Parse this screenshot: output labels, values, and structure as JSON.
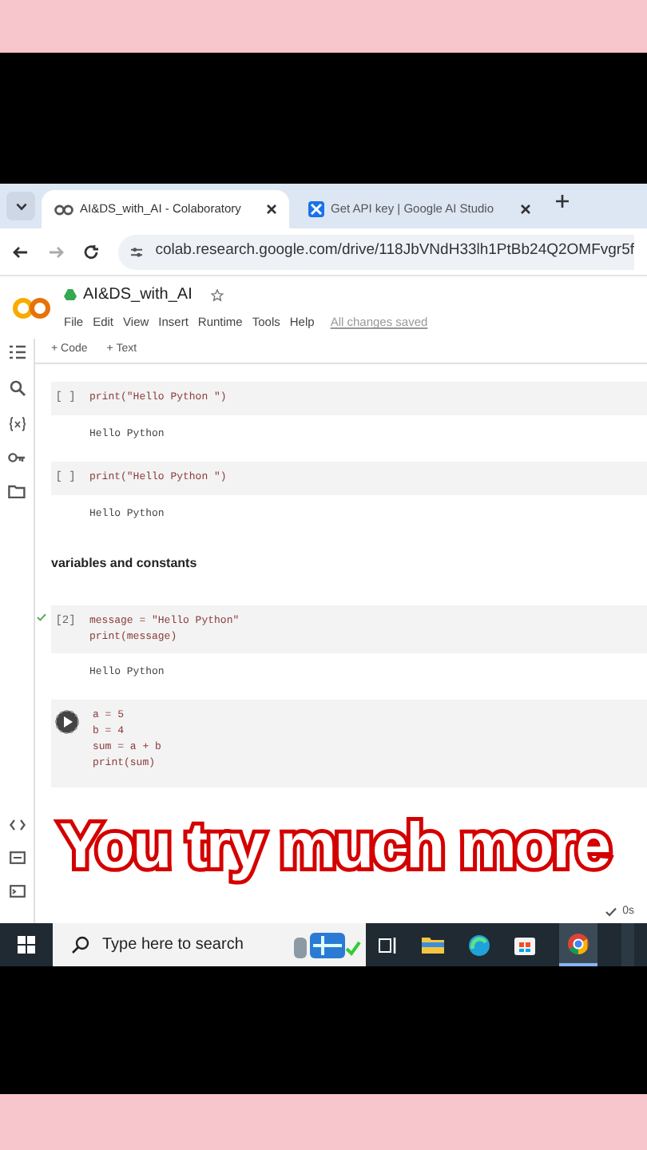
{
  "tabs": [
    {
      "label": "AI&DS_with_AI - Colaboratory",
      "selected": true
    },
    {
      "label": "Get API key | Google AI Studio",
      "selected": false
    }
  ],
  "address": "colab.research.google.com/drive/118JbVNdH33lh1PtBb24Q2OMFvgr5f",
  "notebook": {
    "title": "AI&DS_with_AI",
    "menu": [
      "File",
      "Edit",
      "View",
      "Insert",
      "Runtime",
      "Tools",
      "Help"
    ],
    "save_status": "All changes saved"
  },
  "toolbar": [
    "+ Code",
    "+ Text"
  ],
  "cells": [
    {
      "kind": "code",
      "prompt": "[ ]",
      "lines": [
        "print(\"Hello Python \")"
      ],
      "output": "Hello Python"
    },
    {
      "kind": "code",
      "prompt": "[ ]",
      "lines": [
        "print(\"Hello Python \")"
      ],
      "output": "Hello Python"
    },
    {
      "kind": "text",
      "text": "variables and constants"
    },
    {
      "kind": "code",
      "prompt": "[2]",
      "ran": true,
      "lines": [
        "message = \"Hello Python\"",
        "print(message)"
      ],
      "output": "Hello Python"
    },
    {
      "kind": "running",
      "lines": [
        "a = 5",
        "b = 4",
        "sum = a + b",
        "print(sum)"
      ]
    }
  ],
  "status": "0s",
  "caption": "You try much more",
  "taskbar": {
    "search_placeholder": "Type here to search"
  }
}
